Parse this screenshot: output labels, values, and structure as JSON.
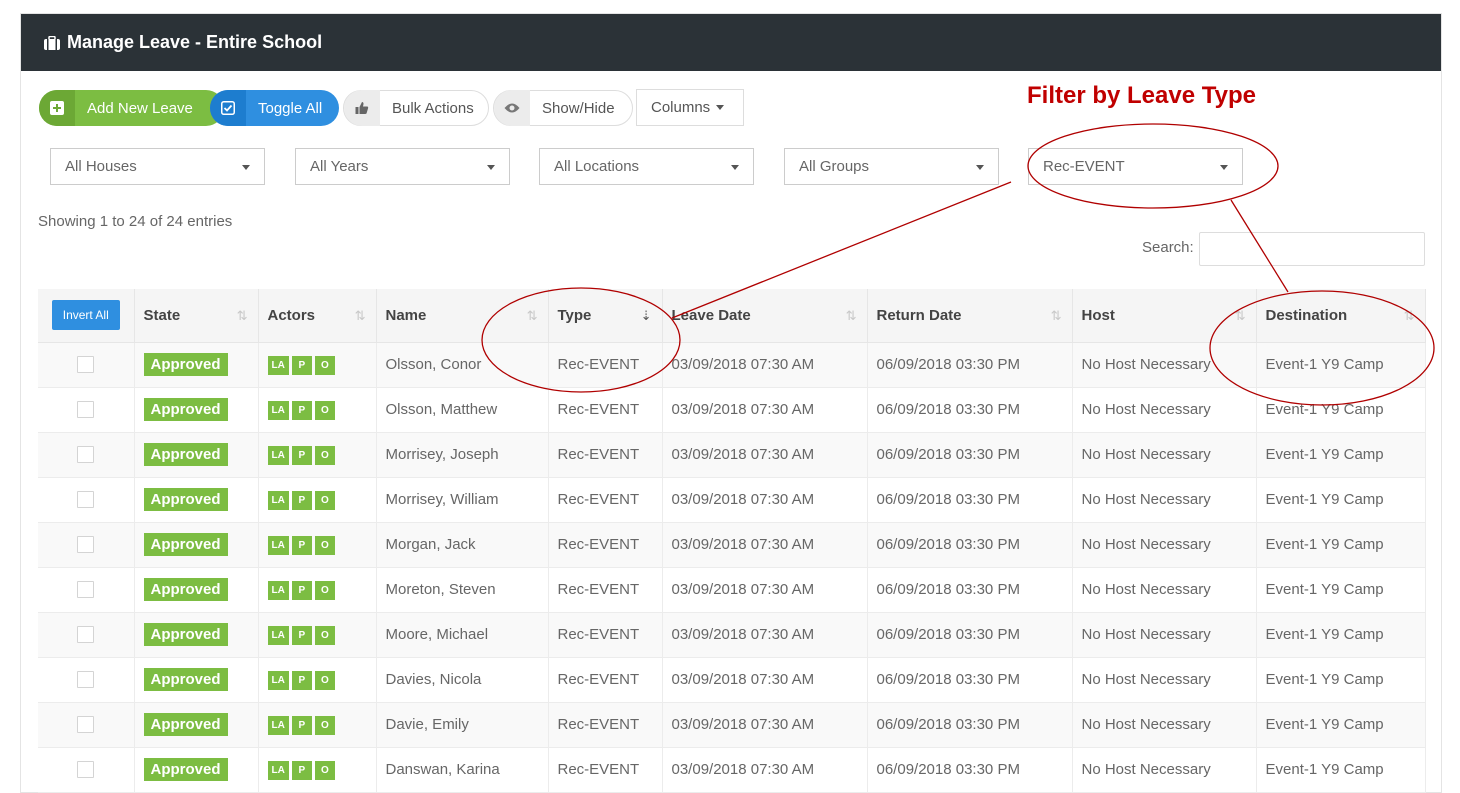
{
  "header": {
    "title": "Manage Leave - Entire School",
    "icon": "briefcase-icon"
  },
  "toolbar": {
    "add_new_leave": "Add New Leave",
    "toggle_all": "Toggle All",
    "bulk_actions": "Bulk Actions",
    "show_hide": "Show/Hide",
    "columns": "Columns"
  },
  "filters": {
    "houses": "All Houses",
    "years": "All Years",
    "locations": "All Locations",
    "groups": "All Groups",
    "leave_type": "Rec-EVENT"
  },
  "annotation": {
    "title": "Filter by Leave Type"
  },
  "info": {
    "showing": "Showing 1 to 24 of 24 entries"
  },
  "search": {
    "label": "Search:"
  },
  "table": {
    "invert_all": "Invert All",
    "columns": [
      "State",
      "Actors",
      "Name",
      "Type",
      "Leave Date",
      "Return Date",
      "Host",
      "Destination"
    ],
    "actor_labels": [
      "LA",
      "P",
      "O"
    ],
    "rows": [
      {
        "state": "Approved",
        "name": "Olsson, Conor",
        "type": "Rec-EVENT",
        "leave": "03/09/2018 07:30 AM",
        "return": "06/09/2018 03:30 PM",
        "host": "No Host Necessary",
        "dest": "Event-1 Y9 Camp"
      },
      {
        "state": "Approved",
        "name": "Olsson, Matthew",
        "type": "Rec-EVENT",
        "leave": "03/09/2018 07:30 AM",
        "return": "06/09/2018 03:30 PM",
        "host": "No Host Necessary",
        "dest": "Event-1 Y9 Camp"
      },
      {
        "state": "Approved",
        "name": "Morrisey, Joseph",
        "type": "Rec-EVENT",
        "leave": "03/09/2018 07:30 AM",
        "return": "06/09/2018 03:30 PM",
        "host": "No Host Necessary",
        "dest": "Event-1 Y9 Camp"
      },
      {
        "state": "Approved",
        "name": "Morrisey, William",
        "type": "Rec-EVENT",
        "leave": "03/09/2018 07:30 AM",
        "return": "06/09/2018 03:30 PM",
        "host": "No Host Necessary",
        "dest": "Event-1 Y9 Camp"
      },
      {
        "state": "Approved",
        "name": "Morgan, Jack",
        "type": "Rec-EVENT",
        "leave": "03/09/2018 07:30 AM",
        "return": "06/09/2018 03:30 PM",
        "host": "No Host Necessary",
        "dest": "Event-1 Y9 Camp"
      },
      {
        "state": "Approved",
        "name": "Moreton, Steven",
        "type": "Rec-EVENT",
        "leave": "03/09/2018 07:30 AM",
        "return": "06/09/2018 03:30 PM",
        "host": "No Host Necessary",
        "dest": "Event-1 Y9 Camp"
      },
      {
        "state": "Approved",
        "name": "Moore, Michael",
        "type": "Rec-EVENT",
        "leave": "03/09/2018 07:30 AM",
        "return": "06/09/2018 03:30 PM",
        "host": "No Host Necessary",
        "dest": "Event-1 Y9 Camp"
      },
      {
        "state": "Approved",
        "name": "Davies, Nicola",
        "type": "Rec-EVENT",
        "leave": "03/09/2018 07:30 AM",
        "return": "06/09/2018 03:30 PM",
        "host": "No Host Necessary",
        "dest": "Event-1 Y9 Camp"
      },
      {
        "state": "Approved",
        "name": "Davie, Emily",
        "type": "Rec-EVENT",
        "leave": "03/09/2018 07:30 AM",
        "return": "06/09/2018 03:30 PM",
        "host": "No Host Necessary",
        "dest": "Event-1 Y9 Camp"
      },
      {
        "state": "Approved",
        "name": "Danswan, Karina",
        "type": "Rec-EVENT",
        "leave": "03/09/2018 07:30 AM",
        "return": "06/09/2018 03:30 PM",
        "host": "No Host Necessary",
        "dest": "Event-1 Y9 Camp"
      }
    ]
  },
  "colors": {
    "header_bg": "#2b3237",
    "green": "#7cbd42",
    "blue": "#2f8fe0",
    "annotation_red": "#c00000"
  }
}
